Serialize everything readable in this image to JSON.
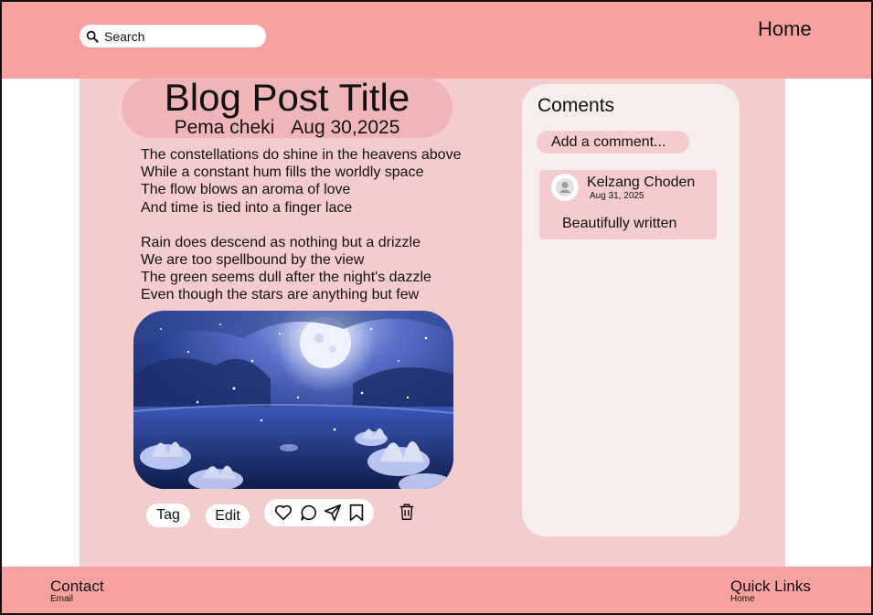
{
  "header": {
    "search_placeholder": "Search",
    "nav_home": "Home"
  },
  "post": {
    "title": "Blog Post Title",
    "author": "Pema cheki",
    "date": "Aug 30,2025",
    "stanzas": [
      [
        "The constellations do shine in the heavens above",
        "While a constant hum fills the worldly space",
        "The flow blows an aroma of love",
        "And time is tied into a finger lace"
      ],
      [
        "Rain does descend as nothing but a drizzle",
        "We are too spellbound by the view",
        "The green seems dull after the night's dazzle",
        "Even though the stars are anything but few"
      ]
    ],
    "image_icon": "night-moon-lotus-landscape",
    "tag_label": "Tag",
    "edit_label": "Edit",
    "actions": [
      "heart-icon",
      "comment-icon",
      "send-icon",
      "bookmark-icon",
      "trash-icon"
    ]
  },
  "comments": {
    "heading": "Coments",
    "add_placeholder": "Add a comment...",
    "items": [
      {
        "author": "Kelzang Choden",
        "date": "Aug 31, 2025",
        "text": "Beautifully written"
      }
    ]
  },
  "footer": {
    "contact_title": "Contact",
    "contact_sub": "Email",
    "quick_title": "Quick Links",
    "quick_sub": "Home"
  },
  "colors": {
    "bar": "#f7a1a0",
    "content_bg": "#f4cccd",
    "title_pill": "#f0b6b7",
    "panel_bg": "#f6eded"
  }
}
